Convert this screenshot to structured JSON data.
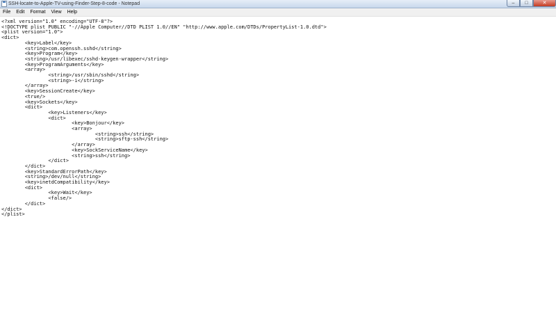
{
  "window": {
    "title": "SSH-locate-to-Apple-TV-using-Finder-Step-8-code - Notepad",
    "minimize_glyph": "–",
    "maximize_glyph": "□",
    "close_glyph": "✕"
  },
  "menu": [
    "File",
    "Edit",
    "Format",
    "View",
    "Help"
  ],
  "editor": {
    "lines": [
      "<?xml version=\"1.0\" encoding=\"UTF-8\"?>",
      "<!DOCTYPE plist PUBLIC \"-//Apple Computer//DTD PLIST 1.0//EN\" \"http://www.apple.com/DTDs/PropertyList-1.0.dtd\">",
      "<plist version=\"1.0\">",
      "<dict>",
      "        <key>Label</key>",
      "        <string>com.openssh.sshd</string>",
      "        <key>Program</key>",
      "        <string>/usr/libexec/sshd-keygen-wrapper</string>",
      "        <key>ProgramArguments</key>",
      "        <array>",
      "                <string>/usr/sbin/sshd</string>",
      "                <string>-i</string>",
      "        </array>",
      "        <key>SessionCreate</key>",
      "        <true/>",
      "        <key>Sockets</key>",
      "        <dict>",
      "                <key>Listeners</key>",
      "                <dict>",
      "                        <key>Bonjour</key>",
      "                        <array>",
      "                                <string>ssh</string>",
      "                                <string>sftp-ssh</string>",
      "                        </array>",
      "                        <key>SockServiceName</key>",
      "                        <string>ssh</string>",
      "                </dict>",
      "        </dict>",
      "        <key>StandardErrorPath</key>",
      "        <string>/dev/null</string>",
      "        <key>inetdCompatibility</key>",
      "        <dict>",
      "                <key>Wait</key>",
      "                <false/>",
      "        </dict>",
      "</dict>",
      "</plist>"
    ]
  }
}
